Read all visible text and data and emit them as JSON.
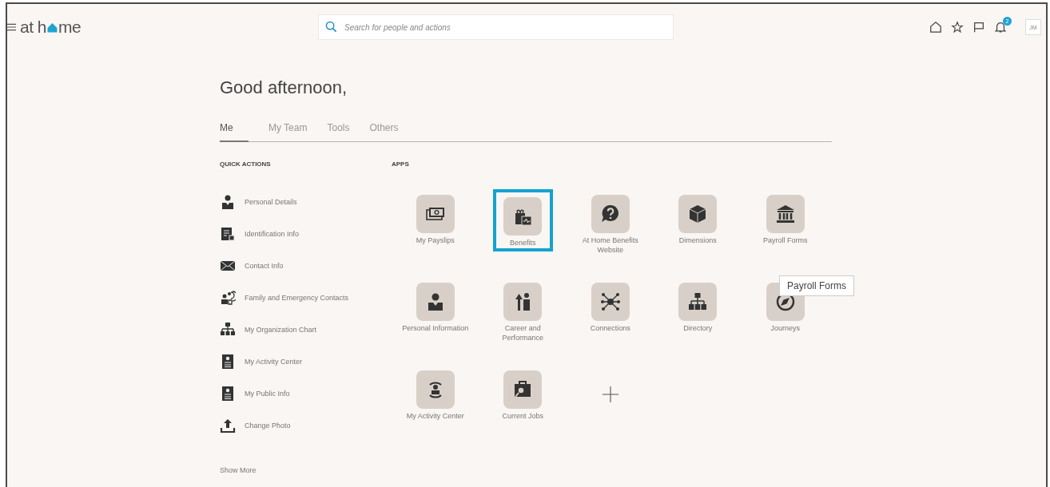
{
  "header": {
    "logo": [
      "at h",
      "me"
    ],
    "search": {
      "placeholder": "Search for people and actions"
    },
    "notifications": "2",
    "user_initials": "JM"
  },
  "greeting": "Good afternoon,",
  "tabs": [
    {
      "label": "Me",
      "selected": true
    },
    {
      "label": "My Team",
      "selected": false
    },
    {
      "label": "Tools",
      "selected": false
    },
    {
      "label": "Others",
      "selected": false
    }
  ],
  "quick_actions": {
    "title": "QUICK ACTIONS",
    "items": [
      {
        "label": "Personal Details",
        "kind": "person"
      },
      {
        "label": "Identification Info",
        "kind": "idcard"
      },
      {
        "label": "Contact Info",
        "kind": "mail"
      },
      {
        "label": "Family and Emergency Contacts",
        "kind": "family"
      },
      {
        "label": "My Organization Chart",
        "kind": "org"
      },
      {
        "label": "My Activity Center",
        "kind": "badge"
      },
      {
        "label": "My Public Info",
        "kind": "badge"
      },
      {
        "label": "Change Photo",
        "kind": "upload"
      }
    ],
    "show_more": "Show More"
  },
  "apps": {
    "title": "APPS",
    "items": [
      {
        "label": "My Payslips",
        "kind": "money",
        "selected": false
      },
      {
        "label": "Benefits",
        "kind": "gift",
        "selected": true
      },
      {
        "label": "At Home Benefits Website",
        "kind": "help",
        "selected": false
      },
      {
        "label": "Dimensions",
        "kind": "cube",
        "selected": false
      },
      {
        "label": "Payroll Forms",
        "kind": "bank",
        "selected": false
      },
      {
        "label": "Personal Information",
        "kind": "person",
        "selected": false
      },
      {
        "label": "Career and Performance",
        "kind": "career",
        "selected": false
      },
      {
        "label": "Connections",
        "kind": "network",
        "selected": false
      },
      {
        "label": "Directory",
        "kind": "org",
        "selected": false
      },
      {
        "label": "Journeys",
        "kind": "compass",
        "selected": false
      },
      {
        "label": "My Activity Center",
        "kind": "activity",
        "selected": false
      },
      {
        "label": "Current Jobs",
        "kind": "jobs",
        "selected": false
      }
    ],
    "tooltip": "Payroll Forms"
  }
}
